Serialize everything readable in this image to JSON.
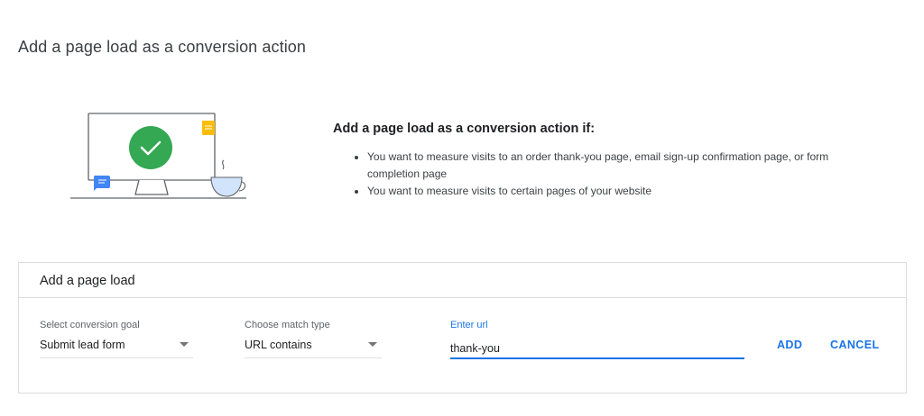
{
  "page": {
    "title": "Add a page load as a conversion action"
  },
  "info": {
    "heading": "Add a page load as a conversion action if:",
    "bullets": [
      "You want to measure visits to an order thank-you page, email sign-up confirmation page, or form completion page",
      "You want to measure visits to certain pages of your website"
    ]
  },
  "card": {
    "title": "Add a page load",
    "goal": {
      "label": "Select conversion goal",
      "value": "Submit lead form"
    },
    "match": {
      "label": "Choose match type",
      "value": "URL contains"
    },
    "url": {
      "label": "Enter url",
      "value": "thank-you"
    },
    "add_label": "ADD",
    "cancel_label": "CANCEL"
  },
  "colors": {
    "accent": "#1a73e8",
    "success": "#34a853",
    "note_yellow": "#fbbc04",
    "chat_blue": "#4285f4"
  },
  "icons": {
    "illustration": "monitor-checkmark-illustration",
    "dropdown": "chevron-down-icon"
  }
}
